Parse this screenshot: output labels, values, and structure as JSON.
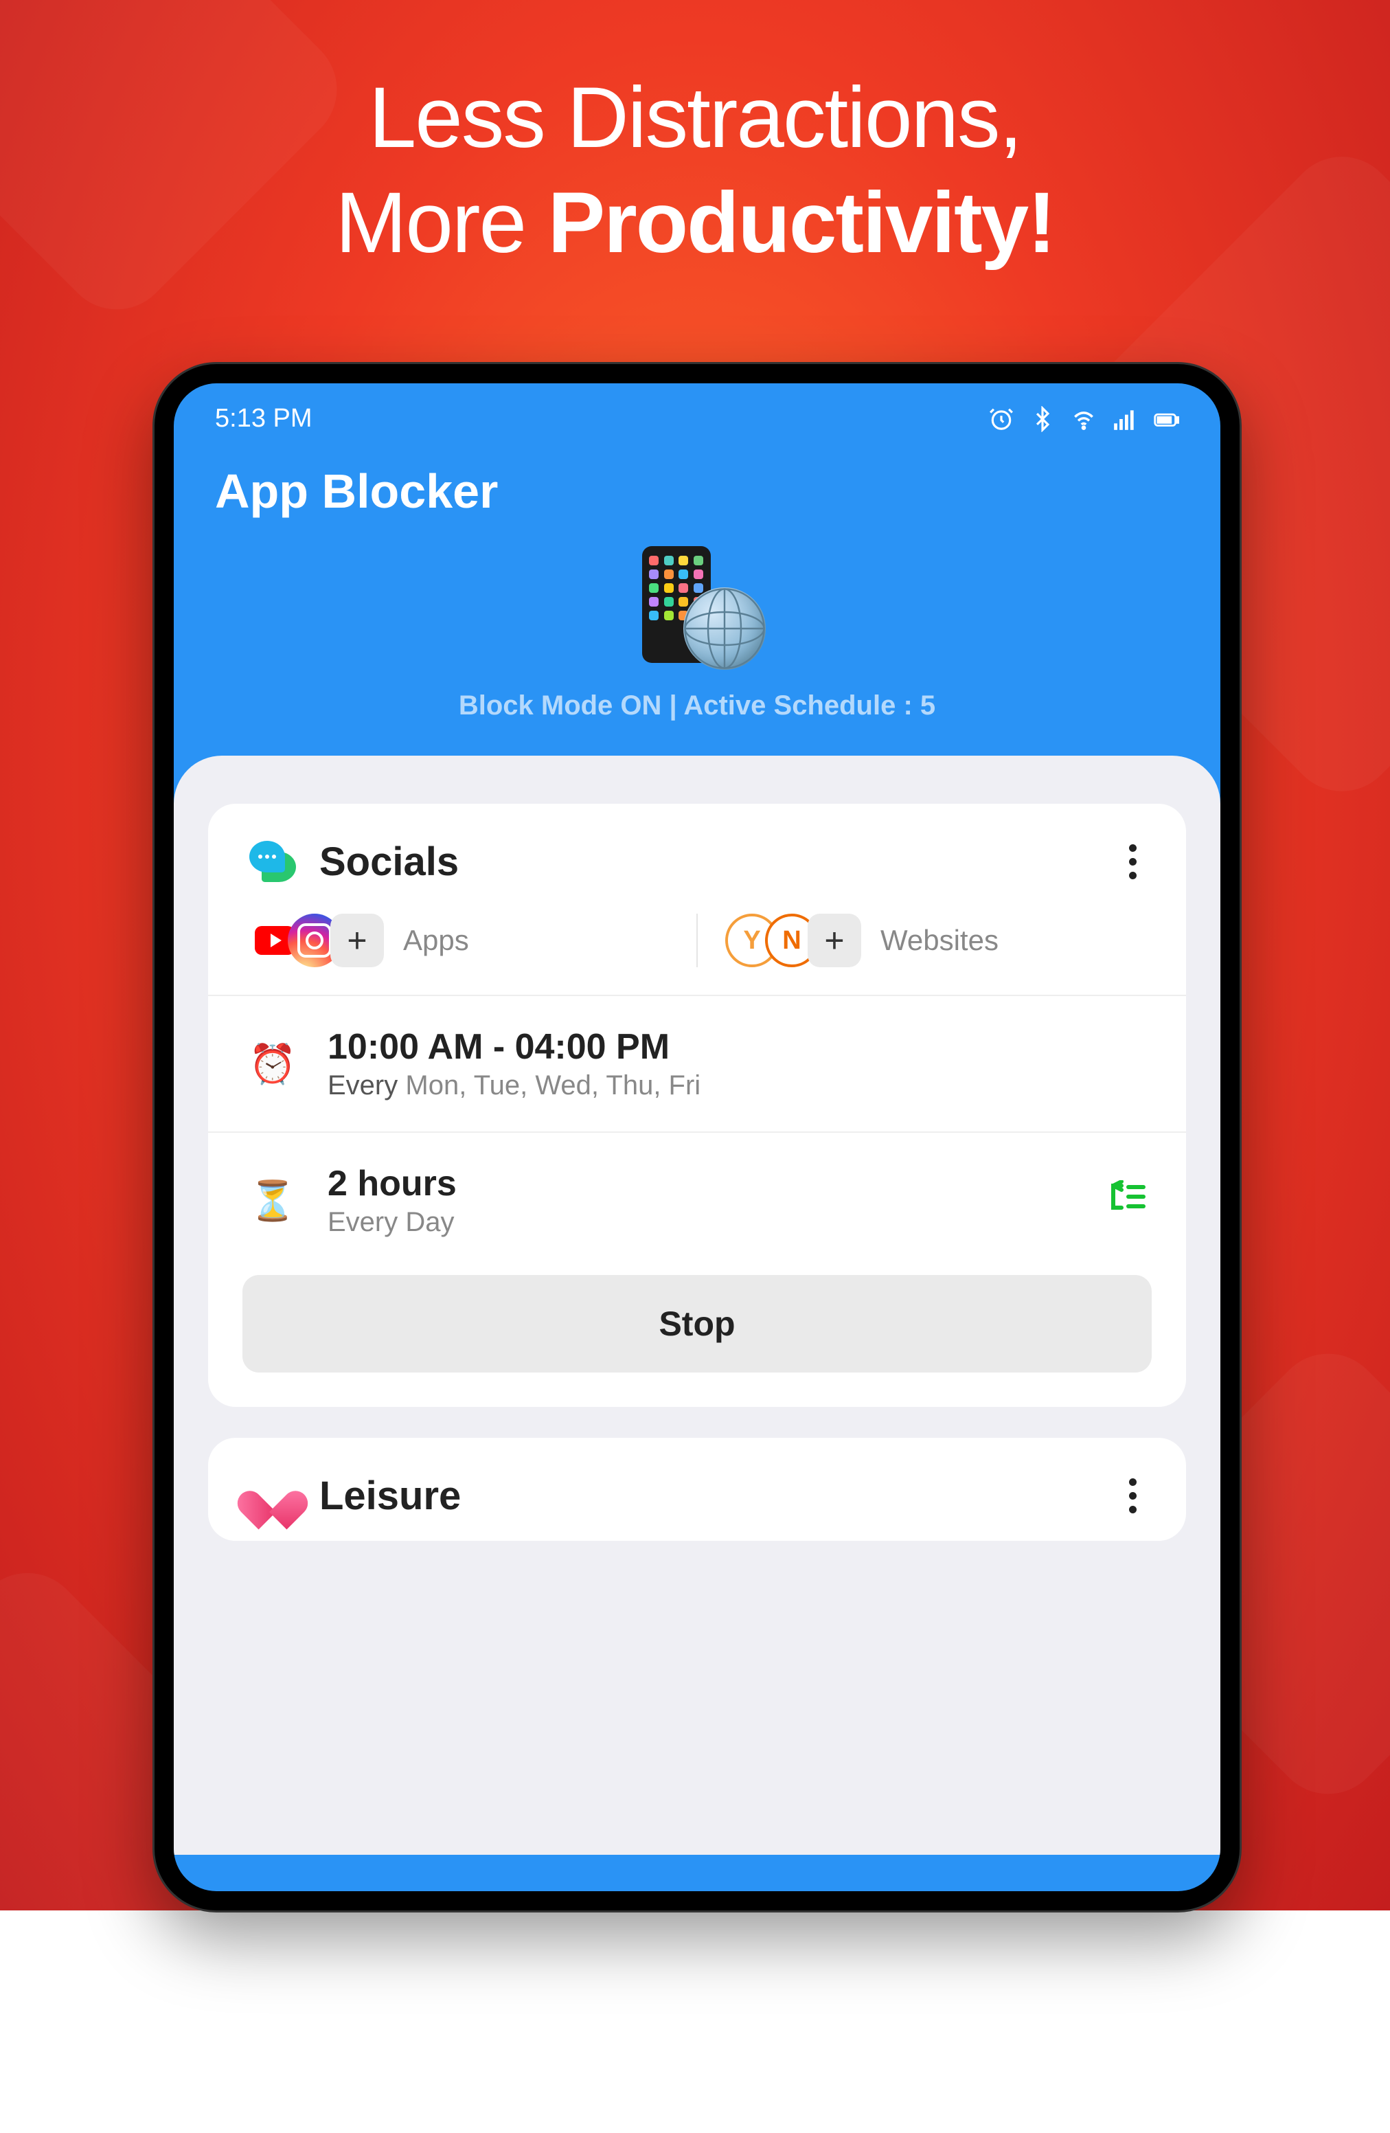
{
  "headline": {
    "line1": "Less Distractions,",
    "line2_pre": "More ",
    "line2_strong": "Productivity!"
  },
  "status_bar": {
    "time": "5:13 PM"
  },
  "app": {
    "title": "App Blocker",
    "status_text": "Block Mode ON | Active Schedule : 5"
  },
  "cards": {
    "socials": {
      "title": "Socials",
      "apps_label": "Apps",
      "websites_label": "Websites",
      "website_icons": [
        "Y",
        "N"
      ],
      "schedule": {
        "time_range": "10:00 AM - 04:00 PM",
        "repeat_prefix": "Every",
        "repeat_days": "Mon, Tue, Wed, Thu, Fri"
      },
      "limit": {
        "duration": "2 hours",
        "frequency": "Every Day"
      },
      "stop_label": "Stop"
    },
    "leisure": {
      "title": "Leisure"
    }
  },
  "icons": {
    "socials": "chat-bubble-icon",
    "leisure": "heart-icon",
    "clock": "⏰",
    "hourglass": "⏳"
  }
}
